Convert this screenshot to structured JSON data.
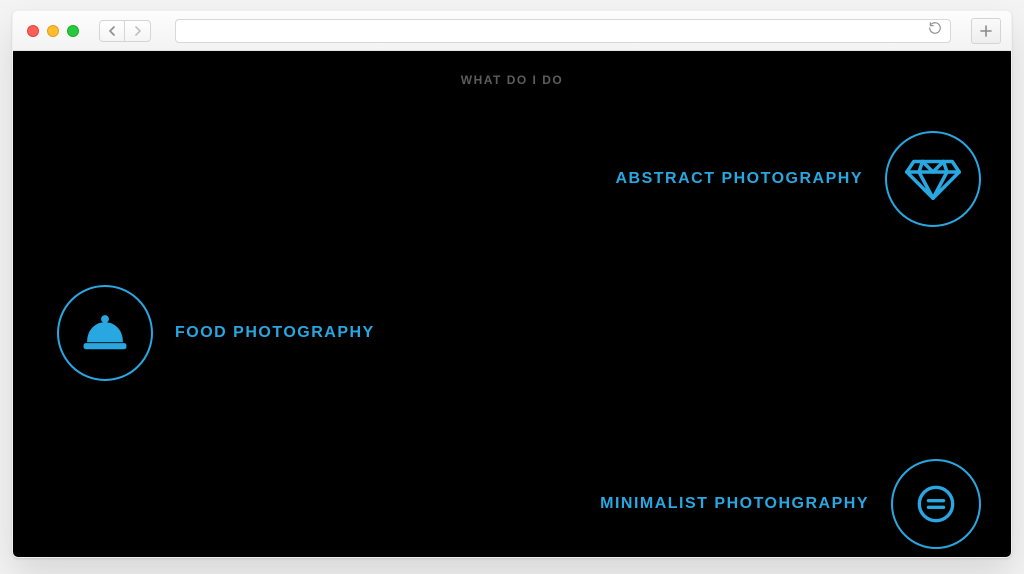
{
  "section_title": "WHAT DO I DO",
  "accent_color": "#29a7e1",
  "services": {
    "abstract": {
      "label": "ABSTRACT PHOTOGRAPHY",
      "icon": "diamond-icon"
    },
    "food": {
      "label": "FOOD PHOTOGRAPHY",
      "icon": "bell-icon"
    },
    "minimal": {
      "label": "MINIMALIST PHOTOHGRAPHY",
      "icon": "equals-icon"
    }
  }
}
